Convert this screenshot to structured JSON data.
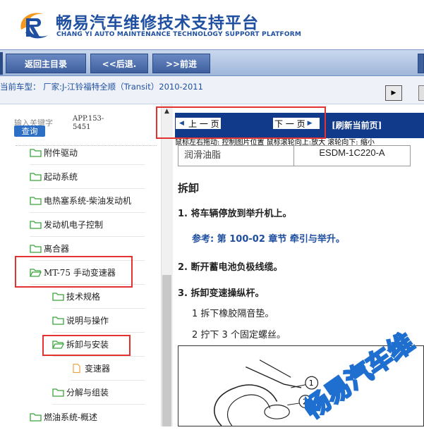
{
  "header": {
    "brand_cn": "畅易汽车维修技术支持平台",
    "brand_en": "CHANG YI AUTO MAINTENANCE TECHNOLOGY SUPPORT PLATFORM"
  },
  "nav": {
    "home_label": "返回主目录",
    "back_label": "<<后退.",
    "forward_label": ">>前进"
  },
  "vehicle": {
    "text": "当前车型： 厂家:J-江铃福特全顺（Transit）2010-2011"
  },
  "search": {
    "label": "输入关键字",
    "button": "查询",
    "app_code": "APP.153-5451"
  },
  "tree": {
    "items": [
      {
        "label": "附件驱动"
      },
      {
        "label": "起动系统"
      },
      {
        "label": "电热塞系统-柴油发动机"
      },
      {
        "label": "发动机电子控制"
      },
      {
        "label": "离合器"
      },
      {
        "label": "MT-75 手动变速器"
      },
      {
        "label": "技术规格"
      },
      {
        "label": "说明与操作"
      },
      {
        "label": "拆卸与安装"
      },
      {
        "label": "变速器"
      },
      {
        "label": "分解与组装"
      },
      {
        "label": "燃油系统-概述"
      }
    ]
  },
  "content": {
    "prev_label": "上 一 页",
    "next_label": "下 一 页",
    "refresh_label": "[刷新当前页]",
    "edge_text": "当",
    "hint": "鼠标左右拖动: 控制图片位置  鼠标滚轮向上:放大  滚轮向下: 缩小",
    "grease_name": "润滑油脂",
    "grease_code": "ESDM-1C220-A",
    "section_title": "拆卸",
    "step1": "1. 将车辆停放到举升机上。",
    "ref1": "参考: 第 100-02 章节 牵引与举升。",
    "step2": "2. 断开蓄电池负极线缆。",
    "step3": "3. 拆卸变速操纵杆。",
    "sub1": "1  拆下橡胶隔音垫。",
    "sub2": "2  拧下 3 个固定螺丝。",
    "callout1": "1",
    "callout2": "2",
    "watermark": "畅易汽车维"
  },
  "colors": {
    "brand_blue": "#1f4fa0",
    "toolbar_blue": "#123a8a",
    "highlight_red": "#e23232",
    "folder_green": "#3aa53a"
  }
}
